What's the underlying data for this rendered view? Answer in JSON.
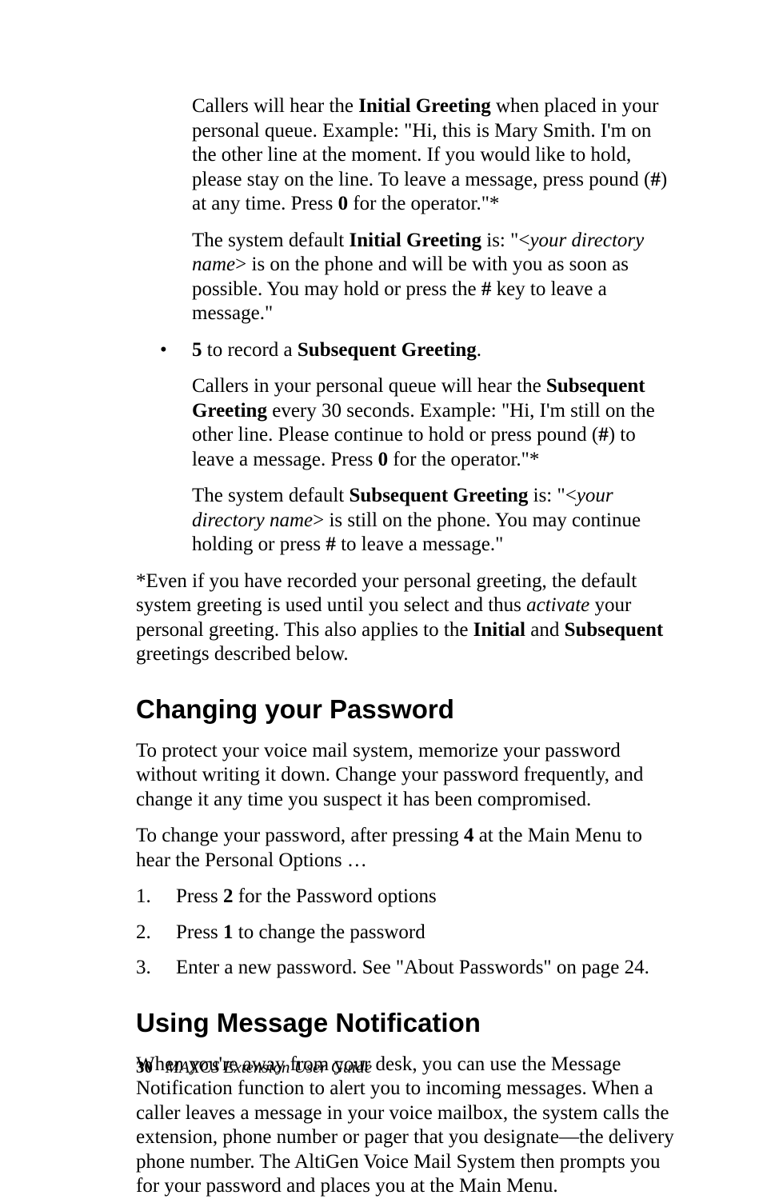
{
  "p1": {
    "a1": "Callers will hear the ",
    "b1": "Initial Greeting",
    "a2": " when placed in your personal queue. Example: \"Hi, this is Mary Smith. I'm on the other line at the moment. If you would like to hold, please stay on the line. To leave a message, press pound (",
    "b2": "#",
    "a3": ") at any time. Press ",
    "b3": "0",
    "a4": " for the operator.\"*"
  },
  "p2": {
    "a1": "The system default ",
    "b1": "Initial Greeting",
    "a2": " is: \"<",
    "i1": "your directory name",
    "a3": "> is on the phone and will be with you as soon as possible. You may hold or press the ",
    "b2": "#",
    "a4": " key to leave a message.\""
  },
  "bullet1": {
    "mark": "•",
    "b1": "5",
    "a1": " to record a ",
    "b2": "Subsequent Greeting",
    "a2": "."
  },
  "p3": {
    "a1": "Callers in your personal queue will hear the ",
    "b1": "Subsequent Greeting",
    "a2": " every 30 seconds. Example: \"Hi, I'm still on the other line. Please continue to hold or press pound (",
    "b2": "#",
    "a3": ") to leave a message. Press ",
    "b3": "0",
    "a4": " for the operator.\"*"
  },
  "p4": {
    "a1": "The system default ",
    "b1": "Subsequent Greeting",
    "a2": " is: \"<",
    "i1": "your directory name",
    "a3": "> is still on the phone. You may continue holding or press ",
    "b2": "#",
    "a4": " to leave a message.\""
  },
  "p5": {
    "a1": "*Even if you have recorded your personal greeting, the default system greeting is used until you select and thus ",
    "i1": "activate",
    "a2": " your personal greeting. This also applies to the ",
    "b1": "Initial",
    "a3": " and ",
    "b2": "Subsequent",
    "a4": " greetings described below."
  },
  "h2a": "Changing your Password",
  "p6": "To protect your voice mail system, memorize your password without writing it down. Change your password frequently, and change it any time you suspect it has been compromised.",
  "p7": {
    "a1": "To change your password, after pressing ",
    "b1": "4",
    "a2": " at the Main Menu to hear the Personal Options …"
  },
  "step1": {
    "n": "1.",
    "a1": "Press ",
    "b1": "2",
    "a2": " for the Password options"
  },
  "step2": {
    "n": "2.",
    "a1": "Press ",
    "b1": "1",
    "a2": " to change the password"
  },
  "step3": {
    "n": "3.",
    "a1": "Enter a new password. See \"About Passwords\" on page 24."
  },
  "h2b": "Using Message Notification",
  "p8": "When you're away from your desk, you can use the Message Notification function to alert you to incoming messages. When a caller leaves a message in your voice mailbox, the system calls the extension, phone number or pager that you designate—the delivery phone number. The AltiGen Voice Mail System then prompts you for your password and places you at the Main Menu.",
  "footer": {
    "page": "30",
    "title": "MAXCS Extension User Guide"
  }
}
